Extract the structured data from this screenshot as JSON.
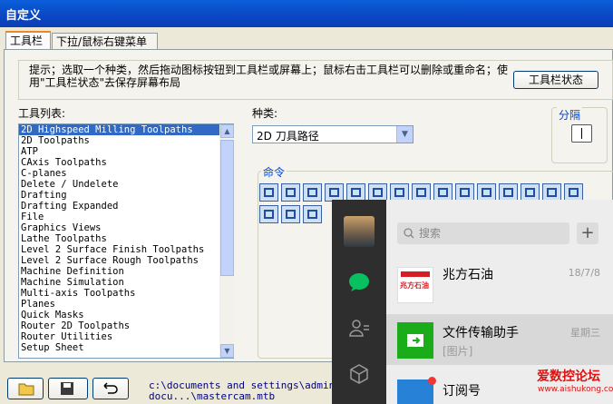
{
  "window": {
    "title": "自定义"
  },
  "tabs": [
    {
      "label": "工具栏",
      "active": true
    },
    {
      "label": "下拉/鼠标右键菜单",
      "active": false
    }
  ],
  "hint": {
    "text": "提示；选取一个种类，然后拖动图标按钮到工具栏或屏幕上；鼠标右击工具栏可以删除或重命名；使用\"工具栏状态\"去保存屏幕布局",
    "button_label": "工具栏状态"
  },
  "toolbar_list": {
    "label": "工具列表:",
    "items": [
      "2D Highspeed Milling Toolpaths",
      "2D Toolpaths",
      "ATP",
      "CAxis Toolpaths",
      "C-planes",
      "Delete / Undelete",
      "Drafting",
      "Drafting Expanded",
      "File",
      "Graphics Views",
      "Lathe Toolpaths",
      "Level 2 Surface Finish Toolpaths",
      "Level 2 Surface Rough Toolpaths",
      "Machine Definition",
      "Machine Simulation",
      "Multi-axis Toolpaths",
      "Planes",
      "Quick Masks",
      "Router 2D Toolpaths",
      "Router Utilities",
      "Setup Sheet"
    ],
    "selected_index": 0
  },
  "category": {
    "label": "种类:",
    "value": "2D 刀具路径"
  },
  "separator": {
    "label": "分隔"
  },
  "commands": {
    "label": "命令"
  },
  "footer": {
    "path_line1": "c:\\documents and settings\\administ",
    "path_line2": "docu...\\mastercam.mtb"
  },
  "wechat": {
    "search_placeholder": "搜索",
    "plus": "+",
    "chats": [
      {
        "name": "兆方石油",
        "time": "18/7/8",
        "sub": "",
        "logo_text": "兆方石油"
      },
      {
        "name": "文件传输助手",
        "time": "星期三",
        "sub": "[图片]"
      },
      {
        "name": "订阅号",
        "time": "",
        "sub": ""
      }
    ]
  },
  "watermark": {
    "title": "爱数控论坛",
    "url": "www.aishukong.com"
  }
}
